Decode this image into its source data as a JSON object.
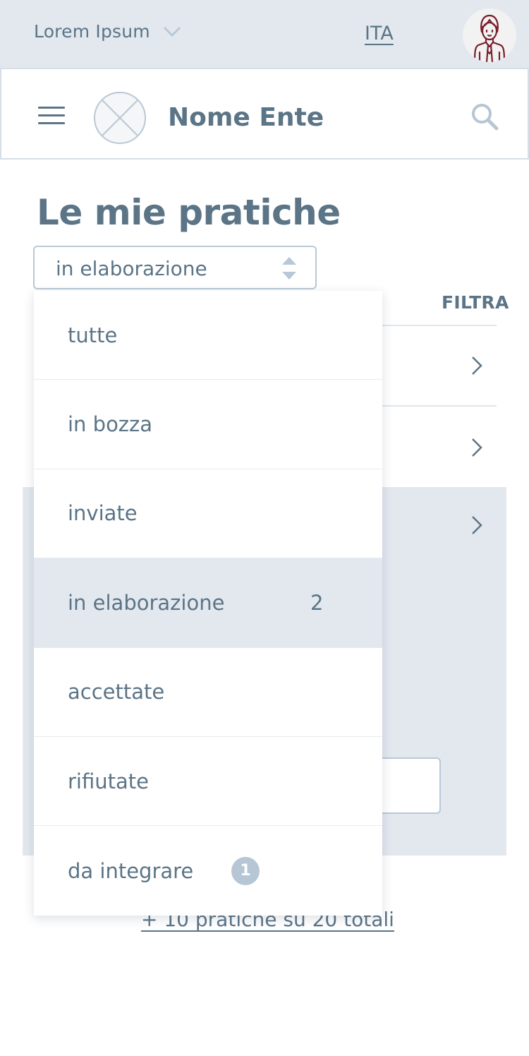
{
  "topbar": {
    "org_name": "Lorem Ipsum",
    "language": "ITA",
    "icons": {
      "org_dropdown": "chevron-down-icon",
      "avatar": "user-avatar-icon"
    }
  },
  "header": {
    "brand_name": "Nome Ente",
    "icons": {
      "menu": "hamburger-icon",
      "logo": "placeholder-logo-icon",
      "search": "search-icon"
    }
  },
  "main": {
    "title": "Le mie pratiche",
    "status_select": {
      "value": "in elaborazione"
    },
    "filter_label": "FILTRA",
    "more_link": "+ 10 pratiche su 20 totali"
  },
  "dropdown": {
    "options": [
      {
        "label": "tutte",
        "count": "",
        "badge": ""
      },
      {
        "label": "in bozza",
        "count": "",
        "badge": ""
      },
      {
        "label": "inviate",
        "count": "",
        "badge": ""
      },
      {
        "label": "in elaborazione",
        "count": "2",
        "badge": "",
        "selected": true
      },
      {
        "label": "accettate",
        "count": "",
        "badge": ""
      },
      {
        "label": "rifiutate",
        "count": "",
        "badge": ""
      },
      {
        "label": "da integrare",
        "count": "",
        "badge": "1"
      }
    ]
  },
  "colors": {
    "primary_text": "#5b7486",
    "topbar_bg": "#e3e8ef",
    "border": "#b9c8d6",
    "badge_bg": "#b7c6d4",
    "avatar_accent": "#7a1e2c"
  }
}
